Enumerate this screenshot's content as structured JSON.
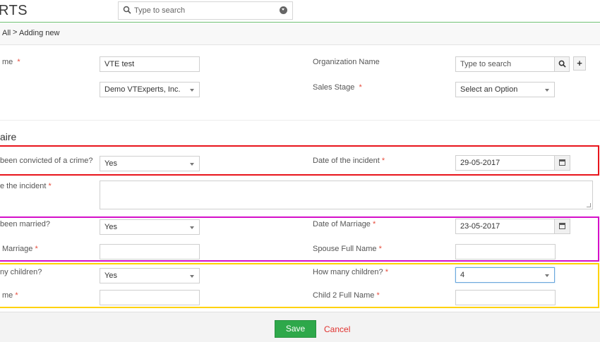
{
  "header": {
    "logo_text": "RTS",
    "search_placeholder": "Type to search"
  },
  "breadcrumb": {
    "parent": "All",
    "separator": ">",
    "current": "Adding new"
  },
  "form": {
    "name_label": "me",
    "name_value": "VTE test",
    "org_label": "Organization Name",
    "org_placeholder": "Type to search",
    "org_add_label": "+",
    "assigned_value": "Demo VTExperts, Inc.",
    "sales_stage_label": "Sales Stage",
    "sales_stage_value": "Select an Option",
    "required_mark": "*"
  },
  "questionnaire": {
    "title": "aire",
    "convicted_label": "been convicted of a crime?",
    "convicted_value": "Yes",
    "incident_date_label": "Date of the incident",
    "incident_date_value": "29-05-2017",
    "incident_desc_label": "e the incident",
    "married_label": "been married?",
    "married_value": "Yes",
    "marriage_date_label": "Date of Marriage",
    "marriage_date_value": "23-05-2017",
    "marriage_place_label": "Marriage",
    "spouse_label": "Spouse Full Name",
    "children_label": "ny children?",
    "children_value": "Yes",
    "how_many_label": "How many children?",
    "how_many_value": "4",
    "child1_label": "me",
    "child2_label": "Child 2 Full Name"
  },
  "footer": {
    "save_label": "Save",
    "cancel_label": "Cancel"
  },
  "colors": {
    "save_green": "#2ea84a",
    "cancel_red": "#e0322f",
    "box_red": "#e8141b",
    "box_magenta": "#d40fc9",
    "box_yellow": "#ffd200"
  }
}
